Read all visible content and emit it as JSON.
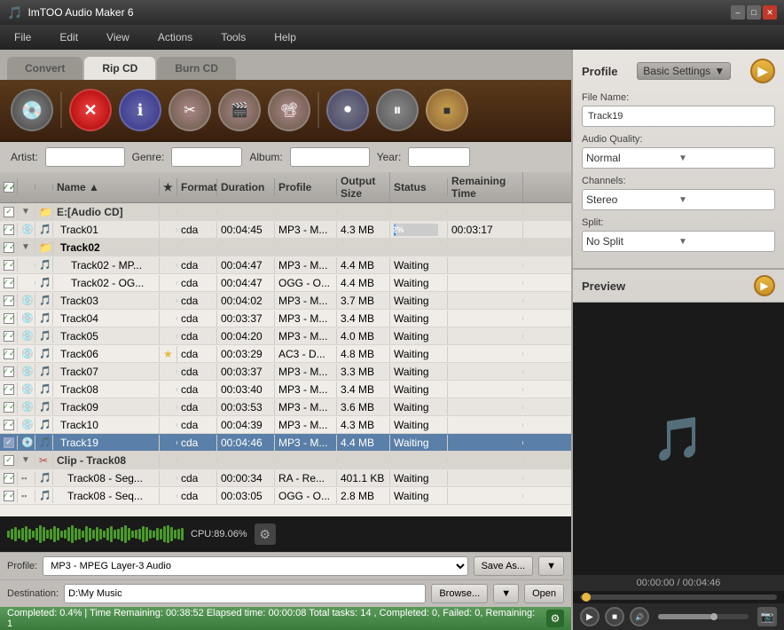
{
  "app": {
    "title": "ImTOO Audio Maker 6",
    "icon": "🎵"
  },
  "titlebar": {
    "minimize": "–",
    "maximize": "□",
    "close": "✕"
  },
  "menubar": {
    "items": [
      {
        "label": "File"
      },
      {
        "label": "Edit"
      },
      {
        "label": "View"
      },
      {
        "label": "Actions"
      },
      {
        "label": "Tools"
      },
      {
        "label": "Help"
      }
    ]
  },
  "tabs": [
    {
      "label": "Convert",
      "active": false
    },
    {
      "label": "Rip CD",
      "active": true
    },
    {
      "label": "Burn CD",
      "active": false
    }
  ],
  "toolbar": {
    "buttons": [
      {
        "name": "cd-button",
        "icon": "💿",
        "type": "cd"
      },
      {
        "name": "delete-button",
        "icon": "✕",
        "type": "red"
      },
      {
        "name": "info-button",
        "icon": "ℹ",
        "type": "info"
      },
      {
        "name": "cut-button",
        "icon": "✂",
        "type": "cut"
      },
      {
        "name": "film-button",
        "icon": "🎬",
        "type": "film"
      },
      {
        "name": "film2-button",
        "icon": "🎞",
        "type": "film2"
      },
      {
        "name": "disc-button",
        "icon": "⏺",
        "type": "disc"
      },
      {
        "name": "pause-button",
        "icon": "⏸",
        "type": "pause"
      },
      {
        "name": "stop-button",
        "icon": "■",
        "type": "stop"
      }
    ]
  },
  "metabar": {
    "artist_label": "Artist:",
    "genre_label": "Genre:",
    "album_label": "Album:",
    "year_label": "Year:",
    "artist_value": "",
    "genre_value": "",
    "album_value": "",
    "year_value": ""
  },
  "table": {
    "headers": [
      {
        "label": "",
        "cls": "col-check"
      },
      {
        "label": "",
        "cls": "col-icon1"
      },
      {
        "label": "",
        "cls": "col-icon2"
      },
      {
        "label": "Name",
        "cls": "col-name"
      },
      {
        "label": "★",
        "cls": "col-star"
      },
      {
        "label": "Format",
        "cls": "col-format"
      },
      {
        "label": "Duration",
        "cls": "col-duration"
      },
      {
        "label": "Profile",
        "cls": "col-profile"
      },
      {
        "label": "Output Size",
        "cls": "col-size"
      },
      {
        "label": "Status",
        "cls": "col-status"
      },
      {
        "label": "Remaining Time",
        "cls": "col-remaining"
      }
    ],
    "rows": [
      {
        "type": "group",
        "level": 0,
        "name": "E:[Audio CD]",
        "indent": 0
      },
      {
        "type": "file",
        "checked": true,
        "level": 1,
        "name": "Track01",
        "format": "cda",
        "duration": "00:04:45",
        "profile": "MP3 - M...",
        "size": "4.3 MB",
        "status": "4.2%",
        "remaining": "00:03:17",
        "highlight": false,
        "progress": true
      },
      {
        "type": "group",
        "level": 1,
        "name": "",
        "indent": 1
      },
      {
        "type": "file",
        "checked": true,
        "level": 2,
        "name": "Track02",
        "format": "",
        "duration": "",
        "profile": "",
        "size": "",
        "status": "",
        "remaining": "",
        "subgroup": true
      },
      {
        "type": "file",
        "checked": true,
        "level": 3,
        "name": "Track02 - MP...",
        "format": "cda",
        "duration": "00:04:47",
        "profile": "MP3 - M...",
        "size": "4.4 MB",
        "status": "Waiting",
        "remaining": ""
      },
      {
        "type": "file",
        "checked": true,
        "level": 3,
        "name": "Track02 - OG...",
        "format": "cda",
        "duration": "00:04:47",
        "profile": "OGG - O...",
        "size": "4.4 MB",
        "status": "Waiting",
        "remaining": ""
      },
      {
        "type": "file",
        "checked": true,
        "level": 1,
        "name": "Track03",
        "format": "cda",
        "duration": "00:04:02",
        "profile": "MP3 - M...",
        "size": "3.7 MB",
        "status": "Waiting",
        "remaining": ""
      },
      {
        "type": "file",
        "checked": true,
        "level": 1,
        "name": "Track04",
        "format": "cda",
        "duration": "00:03:37",
        "profile": "MP3 - M...",
        "size": "3.4 MB",
        "status": "Waiting",
        "remaining": ""
      },
      {
        "type": "file",
        "checked": true,
        "level": 1,
        "name": "Track05",
        "format": "cda",
        "duration": "00:04:20",
        "profile": "MP3 - M...",
        "size": "4.0 MB",
        "status": "Waiting",
        "remaining": ""
      },
      {
        "type": "file",
        "checked": true,
        "level": 1,
        "name": "Track06",
        "format": "cda",
        "duration": "00:03:29",
        "profile": "AC3 - D...",
        "size": "4.8 MB",
        "status": "Waiting",
        "remaining": "",
        "star": true
      },
      {
        "type": "file",
        "checked": true,
        "level": 1,
        "name": "Track07",
        "format": "cda",
        "duration": "00:03:37",
        "profile": "MP3 - M...",
        "size": "3.3 MB",
        "status": "Waiting",
        "remaining": ""
      },
      {
        "type": "file",
        "checked": true,
        "level": 1,
        "name": "Track08",
        "format": "cda",
        "duration": "00:03:40",
        "profile": "MP3 - M...",
        "size": "3.4 MB",
        "status": "Waiting",
        "remaining": ""
      },
      {
        "type": "file",
        "checked": true,
        "level": 1,
        "name": "Track09",
        "format": "cda",
        "duration": "00:03:53",
        "profile": "MP3 - M...",
        "size": "3.6 MB",
        "status": "Waiting",
        "remaining": ""
      },
      {
        "type": "file",
        "checked": true,
        "level": 1,
        "name": "Track10",
        "format": "cda",
        "duration": "00:04:39",
        "profile": "MP3 - M...",
        "size": "4.3 MB",
        "status": "Waiting",
        "remaining": ""
      },
      {
        "type": "file",
        "checked": true,
        "level": 1,
        "name": "Track19",
        "format": "cda",
        "duration": "00:04:46",
        "profile": "MP3 - M...",
        "size": "4.4 MB",
        "status": "Waiting",
        "remaining": "",
        "highlight": true
      },
      {
        "type": "group",
        "level": 0,
        "name": "Clip - Track08",
        "indent": 0
      },
      {
        "type": "file",
        "checked": true,
        "level": 2,
        "name": "Track08 - Seg...",
        "format": "cda",
        "duration": "00:00:34",
        "profile": "RA - Re...",
        "size": "401.1 KB",
        "status": "Waiting",
        "remaining": ""
      },
      {
        "type": "file",
        "checked": true,
        "level": 2,
        "name": "Track08 - Seq...",
        "format": "cda",
        "duration": "00:03:05",
        "profile": "OGG - O...",
        "size": "2.8 MB",
        "status": "Waiting",
        "remaining": ""
      }
    ]
  },
  "waveform": {
    "cpu": "CPU:89.06%"
  },
  "profilebar": {
    "label": "Profile:",
    "value": "MP3 - MPEG Layer-3 Audio",
    "save_as": "Save As...",
    "save_dropdown": "▼"
  },
  "destbar": {
    "label": "Destination:",
    "value": "D:\\My Music",
    "browse": "Browse...",
    "browse_dropdown": "▼",
    "open": "Open"
  },
  "statusbar": {
    "text": "Completed: 0.4%  |  Time Remaining: 00:38:52  Elapsed time: 00:00:08  Total tasks: 14 , Completed: 0, Failed: 0, Remaining: 1"
  },
  "rightpanel": {
    "profile": {
      "title": "Profile",
      "settings_label": "Basic Settings",
      "filename_label": "File Name:",
      "filename_value": "Track19",
      "quality_label": "Audio Quality:",
      "quality_value": "Normal",
      "channels_label": "Channels:",
      "channels_value": "Stereo",
      "split_label": "Split:",
      "split_value": "No Split"
    },
    "preview": {
      "title": "Preview",
      "time": "00:00:00 / 00:04:46"
    }
  }
}
